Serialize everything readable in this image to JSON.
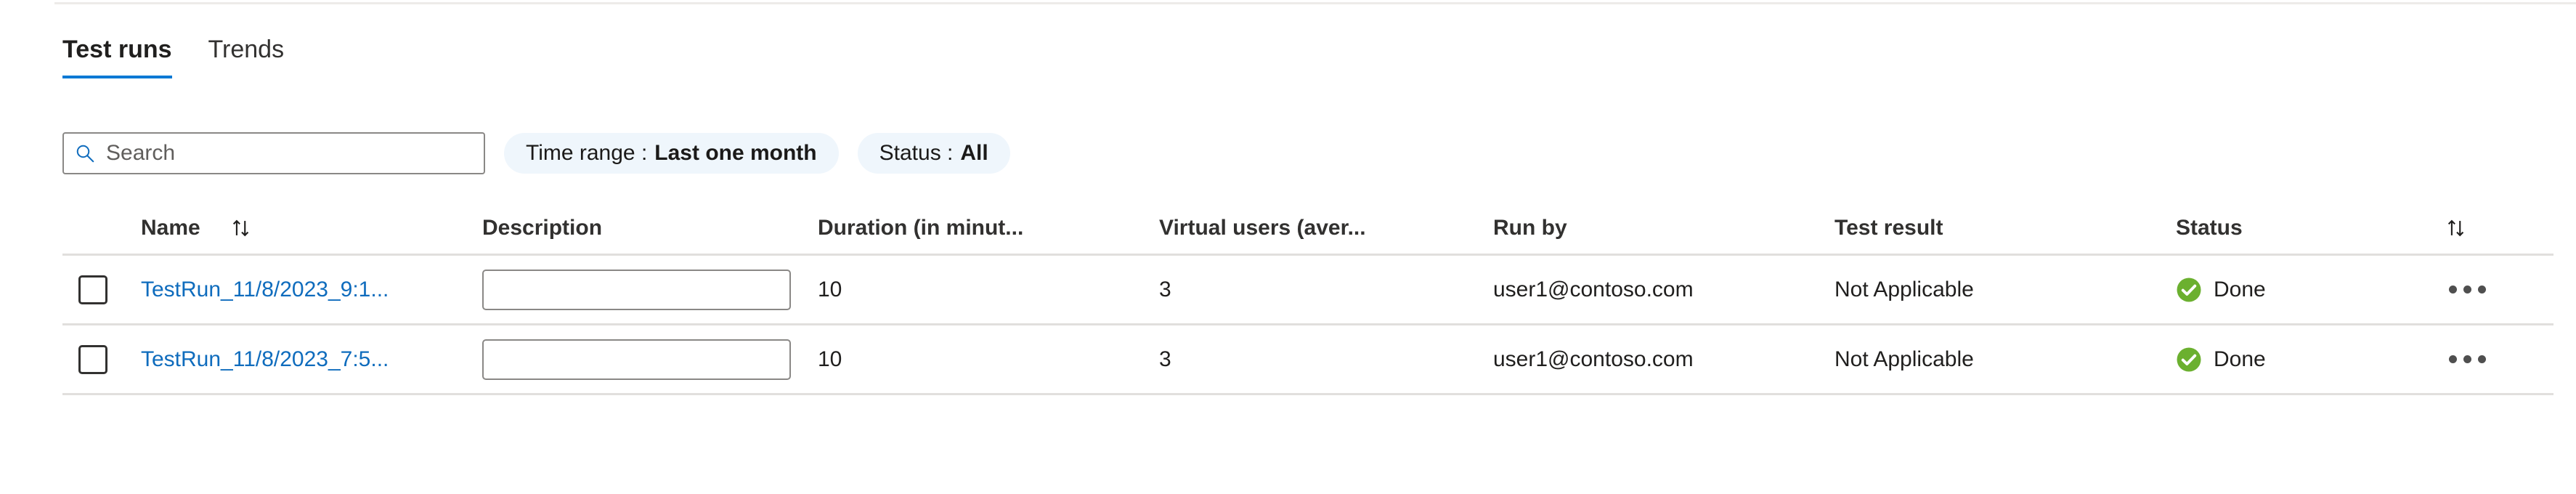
{
  "colors": {
    "accent": "#0078d4",
    "link": "#0f6cbd",
    "pill_bg": "#eff6fc",
    "status_done_green": "#6bb02f",
    "border": "#8a8886",
    "divider": "#e1dfdd"
  },
  "tabs": [
    {
      "label": "Test runs",
      "active": true,
      "name": "tab-test-runs"
    },
    {
      "label": "Trends",
      "active": false,
      "name": "tab-trends"
    }
  ],
  "filters": {
    "search": {
      "placeholder": "Search",
      "value": "",
      "icon": "search-icon"
    },
    "pills": [
      {
        "label": "Time range :",
        "value": "Last one month",
        "name": "filter-pill-time-range"
      },
      {
        "label": "Status :",
        "value": "All",
        "name": "filter-pill-status"
      }
    ]
  },
  "table": {
    "columns": [
      {
        "key": "select",
        "label": "",
        "sortable": false
      },
      {
        "key": "name",
        "label": "Name",
        "sortable": true
      },
      {
        "key": "description",
        "label": "Description",
        "sortable": false
      },
      {
        "key": "duration",
        "label": "Duration (in minut...",
        "sortable": false
      },
      {
        "key": "virtual",
        "label": "Virtual users (aver...",
        "sortable": false
      },
      {
        "key": "runby",
        "label": "Run by",
        "sortable": false
      },
      {
        "key": "result",
        "label": "Test result",
        "sortable": false
      },
      {
        "key": "status",
        "label": "Status",
        "sortable": false
      },
      {
        "key": "actions",
        "label": "",
        "sortable": true
      }
    ],
    "sort_icon": "sort-ascending-descending-icon",
    "rows": [
      {
        "selected": false,
        "name": "TestRun_11/8/2023_9:1...",
        "description": "",
        "description_placeholder": "",
        "duration": "10",
        "virtual_users": "3",
        "run_by": "user1@contoso.com",
        "test_result": "Not Applicable",
        "status": "Done",
        "status_icon": "check-circle-icon",
        "more_icon": "more-options-icon"
      },
      {
        "selected": false,
        "name": "TestRun_11/8/2023_7:5...",
        "description": "",
        "description_placeholder": "",
        "duration": "10",
        "virtual_users": "3",
        "run_by": "user1@contoso.com",
        "test_result": "Not Applicable",
        "status": "Done",
        "status_icon": "check-circle-icon",
        "more_icon": "more-options-icon"
      }
    ]
  }
}
